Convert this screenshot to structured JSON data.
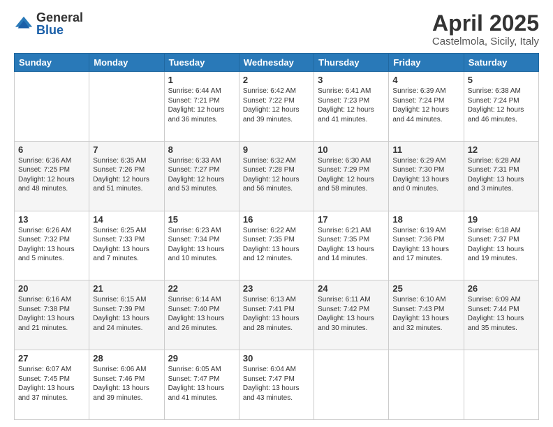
{
  "logo": {
    "general": "General",
    "blue": "Blue"
  },
  "title": "April 2025",
  "subtitle": "Castelmola, Sicily, Italy",
  "days": [
    "Sunday",
    "Monday",
    "Tuesday",
    "Wednesday",
    "Thursday",
    "Friday",
    "Saturday"
  ],
  "weeks": [
    [
      {
        "num": "",
        "info": ""
      },
      {
        "num": "",
        "info": ""
      },
      {
        "num": "1",
        "info": "Sunrise: 6:44 AM\nSunset: 7:21 PM\nDaylight: 12 hours and 36 minutes."
      },
      {
        "num": "2",
        "info": "Sunrise: 6:42 AM\nSunset: 7:22 PM\nDaylight: 12 hours and 39 minutes."
      },
      {
        "num": "3",
        "info": "Sunrise: 6:41 AM\nSunset: 7:23 PM\nDaylight: 12 hours and 41 minutes."
      },
      {
        "num": "4",
        "info": "Sunrise: 6:39 AM\nSunset: 7:24 PM\nDaylight: 12 hours and 44 minutes."
      },
      {
        "num": "5",
        "info": "Sunrise: 6:38 AM\nSunset: 7:24 PM\nDaylight: 12 hours and 46 minutes."
      }
    ],
    [
      {
        "num": "6",
        "info": "Sunrise: 6:36 AM\nSunset: 7:25 PM\nDaylight: 12 hours and 48 minutes."
      },
      {
        "num": "7",
        "info": "Sunrise: 6:35 AM\nSunset: 7:26 PM\nDaylight: 12 hours and 51 minutes."
      },
      {
        "num": "8",
        "info": "Sunrise: 6:33 AM\nSunset: 7:27 PM\nDaylight: 12 hours and 53 minutes."
      },
      {
        "num": "9",
        "info": "Sunrise: 6:32 AM\nSunset: 7:28 PM\nDaylight: 12 hours and 56 minutes."
      },
      {
        "num": "10",
        "info": "Sunrise: 6:30 AM\nSunset: 7:29 PM\nDaylight: 12 hours and 58 minutes."
      },
      {
        "num": "11",
        "info": "Sunrise: 6:29 AM\nSunset: 7:30 PM\nDaylight: 13 hours and 0 minutes."
      },
      {
        "num": "12",
        "info": "Sunrise: 6:28 AM\nSunset: 7:31 PM\nDaylight: 13 hours and 3 minutes."
      }
    ],
    [
      {
        "num": "13",
        "info": "Sunrise: 6:26 AM\nSunset: 7:32 PM\nDaylight: 13 hours and 5 minutes."
      },
      {
        "num": "14",
        "info": "Sunrise: 6:25 AM\nSunset: 7:33 PM\nDaylight: 13 hours and 7 minutes."
      },
      {
        "num": "15",
        "info": "Sunrise: 6:23 AM\nSunset: 7:34 PM\nDaylight: 13 hours and 10 minutes."
      },
      {
        "num": "16",
        "info": "Sunrise: 6:22 AM\nSunset: 7:35 PM\nDaylight: 13 hours and 12 minutes."
      },
      {
        "num": "17",
        "info": "Sunrise: 6:21 AM\nSunset: 7:35 PM\nDaylight: 13 hours and 14 minutes."
      },
      {
        "num": "18",
        "info": "Sunrise: 6:19 AM\nSunset: 7:36 PM\nDaylight: 13 hours and 17 minutes."
      },
      {
        "num": "19",
        "info": "Sunrise: 6:18 AM\nSunset: 7:37 PM\nDaylight: 13 hours and 19 minutes."
      }
    ],
    [
      {
        "num": "20",
        "info": "Sunrise: 6:16 AM\nSunset: 7:38 PM\nDaylight: 13 hours and 21 minutes."
      },
      {
        "num": "21",
        "info": "Sunrise: 6:15 AM\nSunset: 7:39 PM\nDaylight: 13 hours and 24 minutes."
      },
      {
        "num": "22",
        "info": "Sunrise: 6:14 AM\nSunset: 7:40 PM\nDaylight: 13 hours and 26 minutes."
      },
      {
        "num": "23",
        "info": "Sunrise: 6:13 AM\nSunset: 7:41 PM\nDaylight: 13 hours and 28 minutes."
      },
      {
        "num": "24",
        "info": "Sunrise: 6:11 AM\nSunset: 7:42 PM\nDaylight: 13 hours and 30 minutes."
      },
      {
        "num": "25",
        "info": "Sunrise: 6:10 AM\nSunset: 7:43 PM\nDaylight: 13 hours and 32 minutes."
      },
      {
        "num": "26",
        "info": "Sunrise: 6:09 AM\nSunset: 7:44 PM\nDaylight: 13 hours and 35 minutes."
      }
    ],
    [
      {
        "num": "27",
        "info": "Sunrise: 6:07 AM\nSunset: 7:45 PM\nDaylight: 13 hours and 37 minutes."
      },
      {
        "num": "28",
        "info": "Sunrise: 6:06 AM\nSunset: 7:46 PM\nDaylight: 13 hours and 39 minutes."
      },
      {
        "num": "29",
        "info": "Sunrise: 6:05 AM\nSunset: 7:47 PM\nDaylight: 13 hours and 41 minutes."
      },
      {
        "num": "30",
        "info": "Sunrise: 6:04 AM\nSunset: 7:47 PM\nDaylight: 13 hours and 43 minutes."
      },
      {
        "num": "",
        "info": ""
      },
      {
        "num": "",
        "info": ""
      },
      {
        "num": "",
        "info": ""
      }
    ]
  ]
}
